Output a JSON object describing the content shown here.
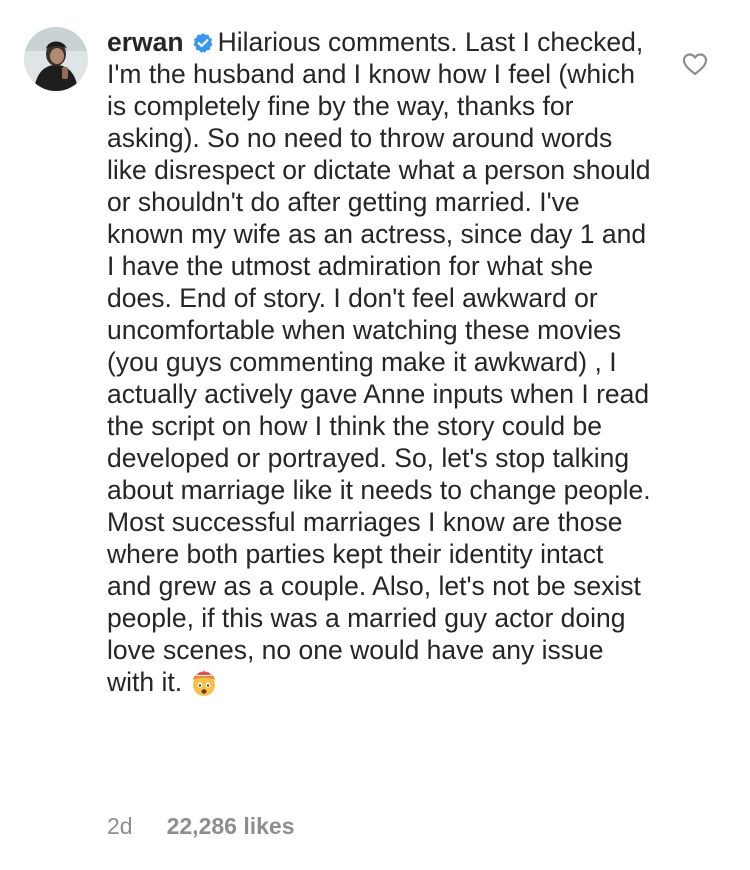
{
  "comment": {
    "username": "erwan",
    "verified": true,
    "text": "Hilarious comments. Last I checked, I'm the husband and I know how I feel (which is completely fine by the way, thanks for asking). So no need to throw around words like disrespect or dictate what a person should or shouldn't do after getting married. I've known my wife as an actress, since day 1 and I have the utmost admiration for what she does. End of story. I don't feel awkward or uncomfortable when watching these movies (you guys commenting make it awkward) , I actually actively gave Anne inputs when I read the script on how I think the story could be developed or portrayed. So, let's stop talking about marriage like it needs to change people. Most successful marriages I know are those where both parties kept their identity intact and grew as a couple. Also, let's not be sexist people, if this was a married guy actor doing love scenes, no one would have any issue with it.",
    "emoji": "exploding-head",
    "time": "2d",
    "likes": "22,286 likes",
    "liked": false
  },
  "colors": {
    "text": "#262626",
    "muted": "#8e8e8e",
    "verified_blue": "#3897f0"
  },
  "icons": {
    "verified": "verified-badge-icon",
    "like": "heart-outline-icon",
    "emoji": "exploding-head-emoji"
  }
}
